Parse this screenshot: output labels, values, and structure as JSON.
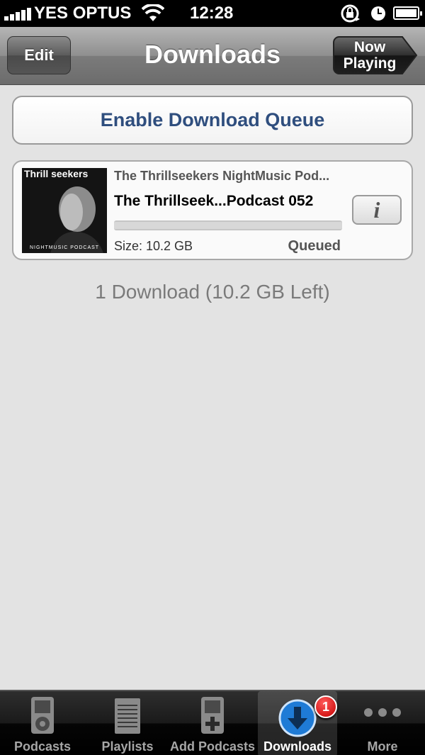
{
  "status_bar": {
    "carrier": "YES OPTUS",
    "time": "12:28"
  },
  "nav": {
    "edit_label": "Edit",
    "title": "Downloads",
    "now_playing_label": "Now Playing"
  },
  "queue_button": {
    "label": "Enable Download Queue"
  },
  "episode": {
    "artwork_text": "Thrill seekers",
    "artwork_subtitle": "NIGHTMUSIC PODCAST",
    "podcast_name": "The Thrillseekers NightMusic Pod...",
    "title": "The Thrillseek...Podcast 052",
    "progress_fraction": 0,
    "size": "Size: 10.2 GB",
    "status": "Queued",
    "info_label": "i"
  },
  "summary": "1 Download (10.2 GB Left)",
  "tabs": [
    {
      "label": "Podcasts",
      "icon": "ipod-icon"
    },
    {
      "label": "Playlists",
      "icon": "playlist-icon"
    },
    {
      "label": "Add Podcasts",
      "icon": "add-podcast-icon"
    },
    {
      "label": "Downloads",
      "icon": "download-arrow-icon",
      "badge": "1",
      "selected": true
    },
    {
      "label": "More",
      "icon": "more-dots-icon"
    }
  ],
  "colors": {
    "accent_text": "#2f4e7e",
    "badge": "#d40000",
    "download_icon": "#1f7bd6"
  }
}
